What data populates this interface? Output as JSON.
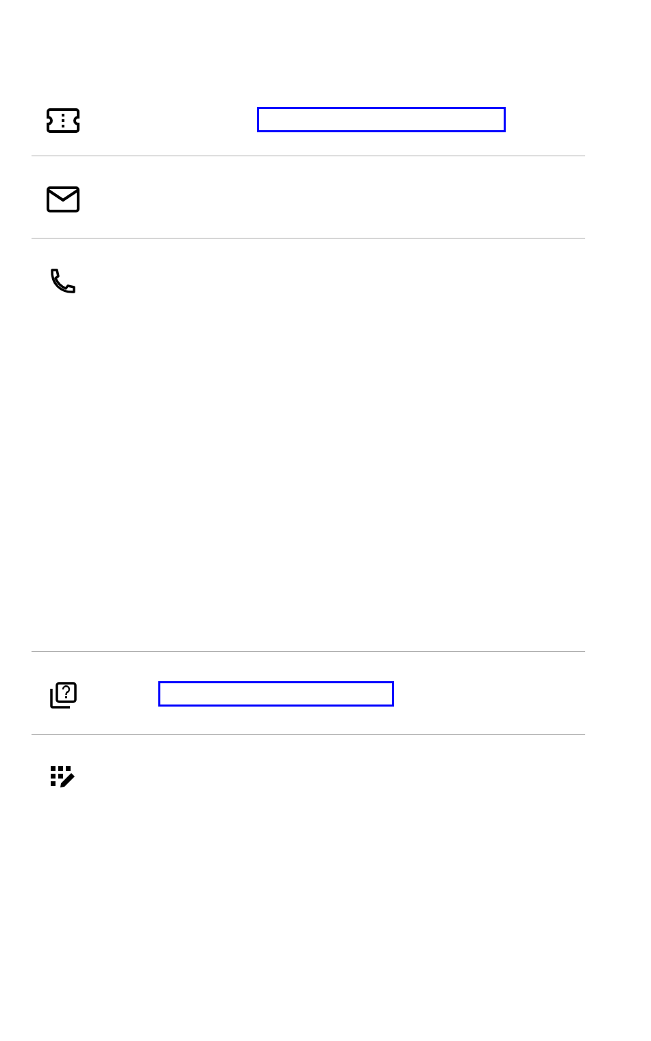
{
  "rows": [
    {
      "kind": "ticket",
      "focused": true
    },
    {
      "kind": "mail",
      "focused": false
    },
    {
      "kind": "phone",
      "focused": false
    },
    {
      "kind": "help",
      "focused": true
    },
    {
      "kind": "dialpad",
      "focused": false
    }
  ]
}
